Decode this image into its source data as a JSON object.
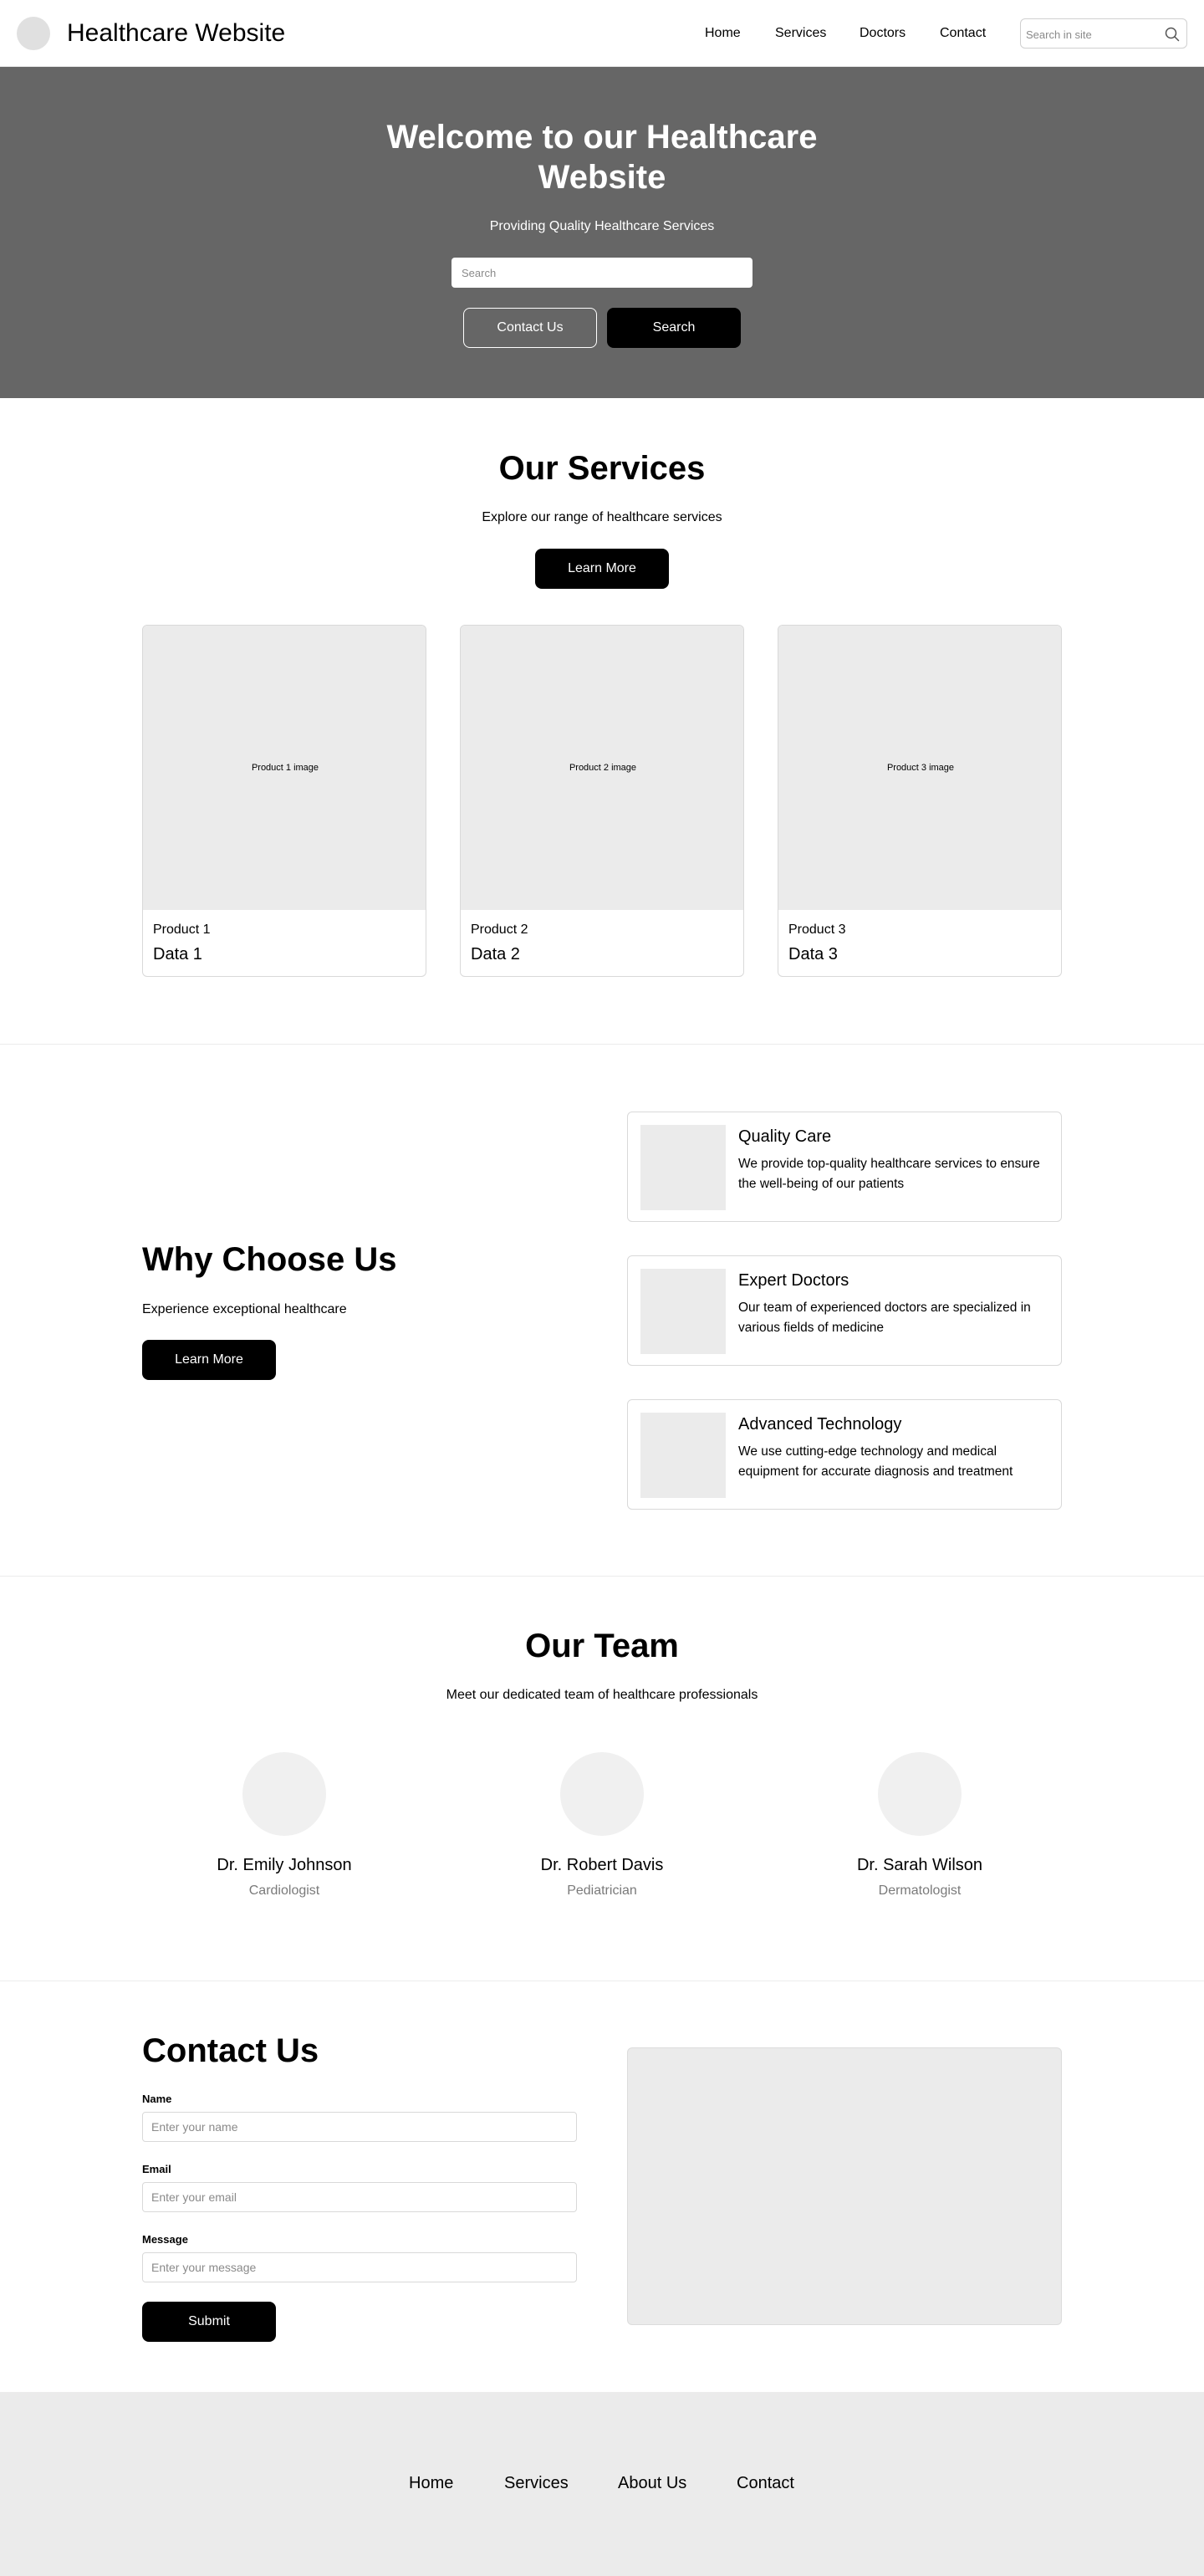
{
  "header": {
    "title": "Healthcare Website",
    "nav": [
      "Home",
      "Services",
      "Doctors",
      "Contact"
    ],
    "search_placeholder": "Search in site"
  },
  "hero": {
    "title": "Welcome to our Healthcare Website",
    "subtitle": "Providing Quality Healthcare Services",
    "search_placeholder": "Search",
    "contact_label": "Contact Us",
    "search_label": "Search"
  },
  "services": {
    "title": "Our Services",
    "subtitle": "Explore our range of healthcare services",
    "button_label": "Learn More",
    "products": [
      {
        "image_label": "Product 1 image",
        "name": "Product 1",
        "data": "Data 1"
      },
      {
        "image_label": "Product 2 image",
        "name": "Product 2",
        "data": "Data 2"
      },
      {
        "image_label": "Product 3 image",
        "name": "Product 3",
        "data": "Data 3"
      }
    ]
  },
  "why": {
    "title": "Why Choose Us",
    "subtitle": "Experience exceptional healthcare",
    "button_label": "Learn More",
    "features": [
      {
        "title": "Quality Care",
        "description": "We provide top-quality healthcare services to ensure the well-being of our patients"
      },
      {
        "title": "Expert Doctors",
        "description": "Our team of experienced doctors are specialized in various fields of medicine"
      },
      {
        "title": "Advanced Technology",
        "description": "We use cutting-edge technology and medical equipment for accurate diagnosis and treatment"
      }
    ]
  },
  "team": {
    "title": "Our Team",
    "subtitle": "Meet our dedicated team of healthcare professionals",
    "members": [
      {
        "name": "Dr. Emily Johnson",
        "role": "Cardiologist"
      },
      {
        "name": "Dr. Robert Davis",
        "role": "Pediatrician"
      },
      {
        "name": "Dr. Sarah Wilson",
        "role": "Dermatologist"
      }
    ]
  },
  "contact": {
    "title": "Contact Us",
    "name_label": "Name",
    "name_placeholder": "Enter your name",
    "email_label": "Email",
    "email_placeholder": "Enter your email",
    "message_label": "Message",
    "message_placeholder": "Enter your message",
    "submit_label": "Submit"
  },
  "footer": {
    "links": [
      "Home",
      "Services",
      "About Us",
      "Contact"
    ]
  },
  "colors": {
    "hero_background": "#666666",
    "primary_button": "#000000",
    "placeholder_gray": "#ebebeb",
    "footer_background": "#ebebeb"
  }
}
